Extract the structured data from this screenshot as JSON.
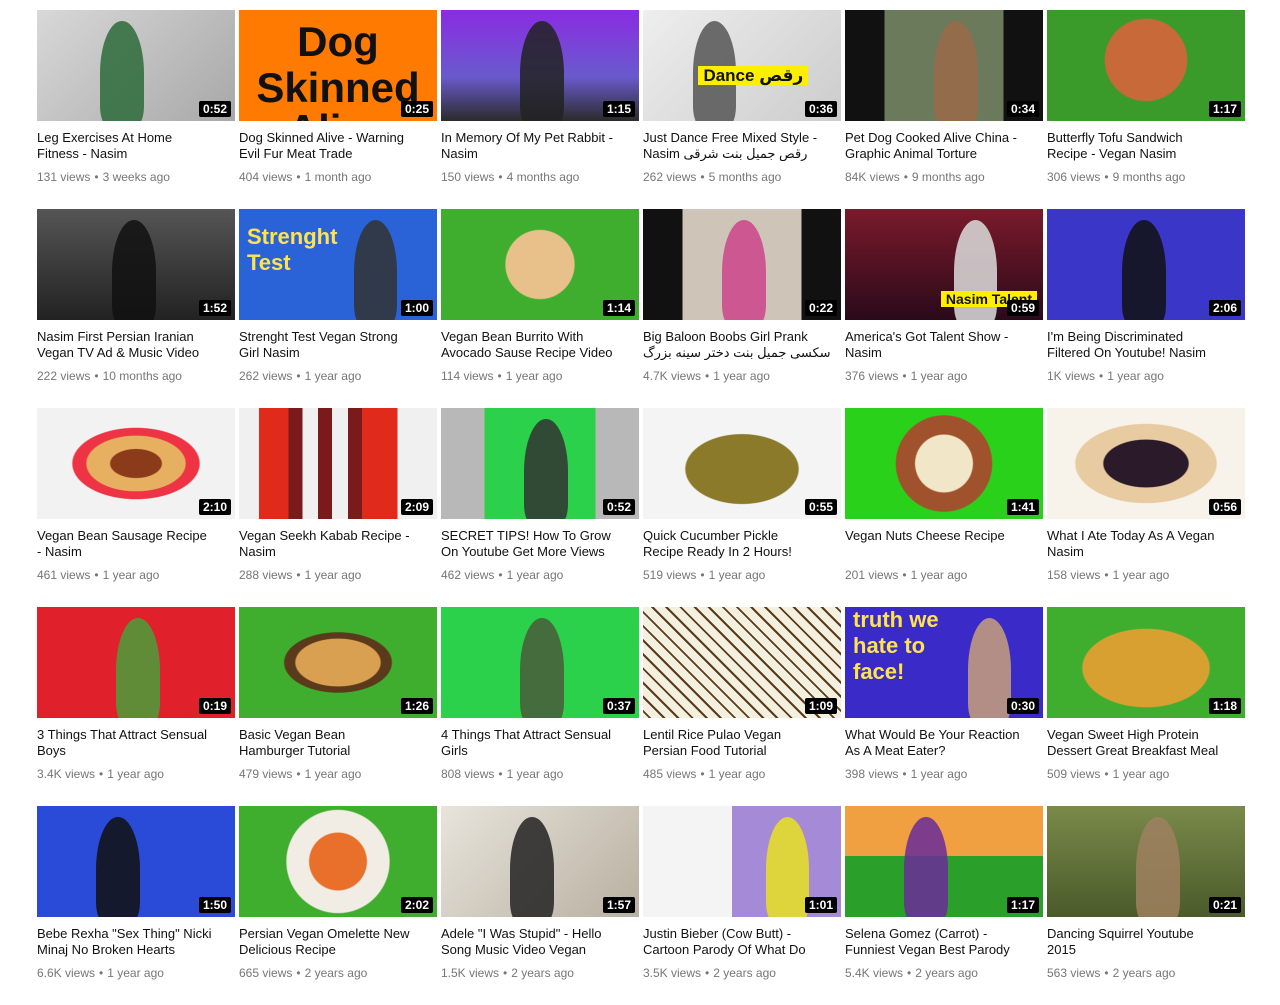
{
  "colors": {
    "duration_bg": "#000000",
    "meta_text": "#767676",
    "title_text": "#111111"
  },
  "videos": [
    {
      "title": "Leg Exercises At Home\nFitness - Nasim",
      "views": "131 views",
      "age": "3 weeks ago",
      "duration": "0:52",
      "bg": "linear-gradient(135deg,#d8d8d8,#a8a8a8)",
      "fig": "#2d6b3a",
      "figL": "32%",
      "caption": "",
      "capColor": "#000",
      "capSize": "0px",
      "capTop": "0%"
    },
    {
      "title": "Dog Skinned Alive - Warning\nEvil Fur Meat Trade",
      "views": "404 views",
      "age": "1 month ago",
      "duration": "0:25",
      "bg": "#ff7a00",
      "fig": "",
      "figL": "0",
      "caption": "Dog",
      "caption2": "Skinned Alive",
      "capColor": "#111",
      "capSize": "42px",
      "capTop": "10%"
    },
    {
      "title": "In Memory Of My Pet Rabbit -\nNasim",
      "views": "150 views",
      "age": "4 months ago",
      "duration": "1:15",
      "bg": "linear-gradient(180deg,#8a2be2,#6a5acd 60%,#2b2b2b)",
      "fig": "#222",
      "figL": "40%",
      "caption": "",
      "capColor": "#000",
      "capSize": "0px",
      "capTop": "0%"
    },
    {
      "title": "Just Dance Free Mixed Style -\nNasim رقص جمیل بنت شرقی",
      "views": "262 views",
      "age": "5 months ago",
      "duration": "0:36",
      "bg": "linear-gradient(135deg,#eeeeee,#cccccc)",
      "fig": "#555",
      "figL": "25%",
      "caption": "Dance رقص",
      "capColor": "#111",
      "capSize": "17px",
      "capTop": "50%",
      "capBg": "#ffee00"
    },
    {
      "title": "Pet Dog Cooked Alive China -\nGraphic Animal Torture",
      "views": "84K views",
      "age": "9 months ago",
      "duration": "0:34",
      "bg": "linear-gradient(90deg,#111 0 20%,#6b7a5a 20% 80%,#111 80%)",
      "fig": "#9a6a4a",
      "figL": "45%",
      "caption": "",
      "capColor": "#000",
      "capSize": "0px",
      "capTop": "0%"
    },
    {
      "title": "Butterfly Tofu Sandwich\nRecipe - Vegan Nasim",
      "views": "306 views",
      "age": "9 months ago",
      "duration": "1:17",
      "bg": "radial-gradient(circle at 50% 45%,#c8693a 0 35%,#3a9a2a 36%)",
      "fig": "",
      "figL": "0",
      "caption": "",
      "capColor": "#000",
      "capSize": "0px",
      "capTop": "0%"
    },
    {
      "title": "Nasim First Persian Iranian\nVegan TV Ad & Music Video",
      "views": "222 views",
      "age": "10 months ago",
      "duration": "1:52",
      "bg": "linear-gradient(180deg,#555,#222)",
      "fig": "#111",
      "figL": "38%",
      "caption": "",
      "capColor": "#000",
      "capSize": "0px",
      "capTop": "0%"
    },
    {
      "title": "Strenght Test Vegan Strong\nGirl Nasim",
      "views": "262 views",
      "age": "1 year ago",
      "duration": "1:00",
      "bg": "#2a63d8",
      "fig": "#333",
      "figL": "58%",
      "caption": "Strenght",
      "caption2": "Test",
      "capColor": "#ffe34d",
      "capSize": "22px",
      "capTop": "15%",
      "capAlign": "left"
    },
    {
      "title": "Vegan Bean Burrito With\nAvocado Sause Recipe Video",
      "views": "114 views",
      "age": "1 year ago",
      "duration": "1:14",
      "bg": "radial-gradient(circle at 50% 50%,#e8c08a 0 30%,#3fae2f 31%)",
      "fig": "",
      "figL": "0",
      "caption": "",
      "capColor": "#000",
      "capSize": "0px",
      "capTop": "0%"
    },
    {
      "title": "Big Baloon Boobs Girl Prank\nسکسی جمیل بنت دختر سینه بزرگ",
      "views": "4.7K views",
      "age": "1 year ago",
      "duration": "0:22",
      "bg": "linear-gradient(90deg,#111 0 20%,#cfc4b8 20% 80%,#111 80%)",
      "fig": "#c48",
      "figL": "40%",
      "caption": "",
      "capColor": "#000",
      "capSize": "0px",
      "capTop": "0%"
    },
    {
      "title": "America's Got Talent Show -\nNasim",
      "views": "376 views",
      "age": "1 year ago",
      "duration": "0:59",
      "bg": "linear-gradient(180deg,#7a1a2a,#2a0a1a)",
      "fig": "#ddd",
      "figL": "55%",
      "caption": "Nasim Talent",
      "capColor": "#111",
      "capSize": "14px",
      "capTop": "74%",
      "capBg": "#ffee00",
      "capAlign": "right"
    },
    {
      "title": "I'm Being Discriminated\nFiltered On Youtube! Nasim",
      "views": "1K views",
      "age": "1 year ago",
      "duration": "2:06",
      "bg": "#3a36c8",
      "fig": "#111",
      "figL": "38%",
      "caption": "",
      "capColor": "#000",
      "capSize": "0px",
      "capTop": "0%"
    },
    {
      "title": "Vegan Bean Sausage Recipe\n- Nasim",
      "views": "461 views",
      "age": "1 year ago",
      "duration": "2:10",
      "bg": "radial-gradient(ellipse at 50% 50%,#8b3a1a 0 18%,#e6b060 19% 35%,#e34 36% 45%,#f2f2f2 46%)",
      "fig": "",
      "figL": "0",
      "caption": "",
      "capColor": "#000",
      "capSize": "0px",
      "capTop": "0%"
    },
    {
      "title": "Vegan Seekh Kabab Recipe -\nNasim",
      "views": "288 views",
      "age": "1 year ago",
      "duration": "2:09",
      "bg": "linear-gradient(90deg,#f0f0f0 0 10%,#e02a1a 10% 25%,#7a1a1a 25% 32%,#f0f0f0 32% 40%,#7a1a1a 40% 47%,#f0f0f0 47% 55%,#7a1a1a 55% 62%,#e02a1a 62% 80%,#f0f0f0 80%)",
      "fig": "",
      "figL": "0",
      "caption": "",
      "capColor": "#000",
      "capSize": "0px",
      "capTop": "0%"
    },
    {
      "title": "SECRET TIPS! How To Grow\nOn Youtube Get More Views",
      "views": "462 views",
      "age": "1 year ago",
      "duration": "0:52",
      "bg": "linear-gradient(90deg,#b8b8b8 0 22%,#2bd14a 22% 78%,#b8b8b8 78%)",
      "fig": "#333",
      "figL": "42%",
      "caption": "",
      "capColor": "#000",
      "capSize": "0px",
      "capTop": "0%"
    },
    {
      "title": "Quick Cucumber Pickle\nRecipe Ready In 2 Hours!",
      "views": "519 views",
      "age": "1 year ago",
      "duration": "0:55",
      "bg": "radial-gradient(ellipse at 50% 55%,#8a7a2a 0 40%,#f4f4f4 41%)",
      "fig": "",
      "figL": "0",
      "caption": "",
      "capColor": "#000",
      "capSize": "0px",
      "capTop": "0%"
    },
    {
      "title": "Vegan Nuts Cheese Recipe",
      "views": "201 views",
      "age": "1 year ago",
      "duration": "1:41",
      "bg": "radial-gradient(circle at 50% 50%,#f1e7c8 0 25%,#a0522d 26% 42%,#2ad11a 43%)",
      "fig": "",
      "figL": "0",
      "caption": "",
      "capColor": "#000",
      "capSize": "0px",
      "capTop": "0%"
    },
    {
      "title": "What I Ate Today As A Vegan\nNasim",
      "views": "158 views",
      "age": "1 year ago",
      "duration": "0:56",
      "bg": "radial-gradient(ellipse at 50% 50%,#2a1a2a 0 30%,#e8cba0 31% 50%,#f7f2ea 51%)",
      "fig": "",
      "figL": "0",
      "caption": "",
      "capColor": "#000",
      "capSize": "0px",
      "capTop": "0%"
    },
    {
      "title": "3 Things That Attract Sensual\nBoys",
      "views": "3.4K views",
      "age": "1 year ago",
      "duration": "0:19",
      "bg": "#e0202a",
      "fig": "#4aa03a",
      "figL": "40%",
      "caption": "",
      "capColor": "#000",
      "capSize": "0px",
      "capTop": "0%"
    },
    {
      "title": "Basic Vegan Bean\nHamburger Tutorial",
      "views": "479 views",
      "age": "1 year ago",
      "duration": "1:26",
      "bg": "radial-gradient(ellipse at 50% 50%,#d8a050 0 30%,#5a3a1a 31% 38%,#3fae2f 39%)",
      "fig": "",
      "figL": "0",
      "caption": "",
      "capColor": "#000",
      "capSize": "0px",
      "capTop": "0%"
    },
    {
      "title": "4 Things That Attract Sensual\nGirls",
      "views": "808 views",
      "age": "1 year ago",
      "duration": "0:37",
      "bg": "#2bd14a",
      "fig": "#4a5a3a",
      "figL": "40%",
      "caption": "",
      "capColor": "#000",
      "capSize": "0px",
      "capTop": "0%"
    },
    {
      "title": "Lentil Rice Pulao Vegan\nPersian Food Tutorial",
      "views": "485 views",
      "age": "1 year ago",
      "duration": "1:09",
      "bg": "repeating-linear-gradient(45deg,#f4f0e0 0 4px,#5a3a1a 4px 6px,#f4f0e0 6px 10px)",
      "fig": "",
      "figL": "0",
      "caption": "",
      "capColor": "#000",
      "capSize": "0px",
      "capTop": "0%"
    },
    {
      "title": "What Would Be Your Reaction\nAs A Meat Eater?",
      "views": "398 views",
      "age": "1 year ago",
      "duration": "0:30",
      "bg": "#3a2ac8",
      "fig": "#c9a07a",
      "figL": "62%",
      "caption": "truth we",
      "caption2": "hate to",
      "caption3": "face!",
      "capColor": "#ffe34d",
      "capSize": "22px",
      "capTop": "2%",
      "capAlign": "left"
    },
    {
      "title": "Vegan Sweet High Protein\nDessert Great Breakfast Meal",
      "views": "509 views",
      "age": "1 year ago",
      "duration": "1:18",
      "bg": "radial-gradient(ellipse at 50% 55%,#d8a030 0 45%,#3fae2f 46%)",
      "fig": "",
      "figL": "0",
      "caption": "",
      "capColor": "#000",
      "capSize": "0px",
      "capTop": "0%"
    },
    {
      "title": "Bebe Rexha \"Sex Thing\" Nicki\nMinaj No Broken Hearts",
      "views": "6.6K views",
      "age": "1 year ago",
      "duration": "1:50",
      "bg": "#2a4ad8",
      "fig": "#111",
      "figL": "30%",
      "caption": "",
      "capColor": "#ffe34d",
      "capSize": "0px",
      "capTop": "0%"
    },
    {
      "title": "Persian Vegan Omelette New\nDelicious Recipe",
      "views": "665 views",
      "age": "2 years ago",
      "duration": "2:02",
      "bg": "radial-gradient(circle at 50% 50%,#e8702a 0 25%,#f2ede4 26% 45%,#3fae2f 46%)",
      "fig": "",
      "figL": "0",
      "caption": "",
      "capColor": "#000",
      "capSize": "0px",
      "capTop": "0%"
    },
    {
      "title": "Adele \"I Was Stupid\" - Hello\nSong Music Video Vegan",
      "views": "1.5K views",
      "age": "2 years ago",
      "duration": "1:57",
      "bg": "linear-gradient(135deg,#e8e4dc,#b8b0a0)",
      "fig": "#222",
      "figL": "35%",
      "caption": "",
      "capColor": "#000",
      "capSize": "0px",
      "capTop": "0%"
    },
    {
      "title": "Justin Bieber (Cow Butt) -\nCartoon Parody Of What Do",
      "views": "3.5K views",
      "age": "2 years ago",
      "duration": "1:01",
      "bg": "linear-gradient(90deg,#f4f4f4 0 45%,#a58ad8 45%)",
      "fig": "#e8e020",
      "figL": "62%",
      "caption": "",
      "capColor": "#000",
      "capSize": "0px",
      "capTop": "0%"
    },
    {
      "title": "Selena Gomez (Carrot) -\nFunniest Vegan Best Parody",
      "views": "5.4K views",
      "age": "2 years ago",
      "duration": "1:17",
      "bg": "linear-gradient(180deg,#f0a040 0 45%,#2aa02a 45%)",
      "fig": "#6a2a9a",
      "figL": "30%",
      "caption": "",
      "capColor": "#000",
      "capSize": "0px",
      "capTop": "0%"
    },
    {
      "title": "Dancing Squirrel Youtube\n2015",
      "views": "563 views",
      "age": "2 years ago",
      "duration": "0:21",
      "bg": "linear-gradient(180deg,#7a8a4a,#4a5a2a)",
      "fig": "#a08060",
      "figL": "45%",
      "caption": "",
      "capColor": "#000",
      "capSize": "0px",
      "capTop": "0%"
    }
  ]
}
